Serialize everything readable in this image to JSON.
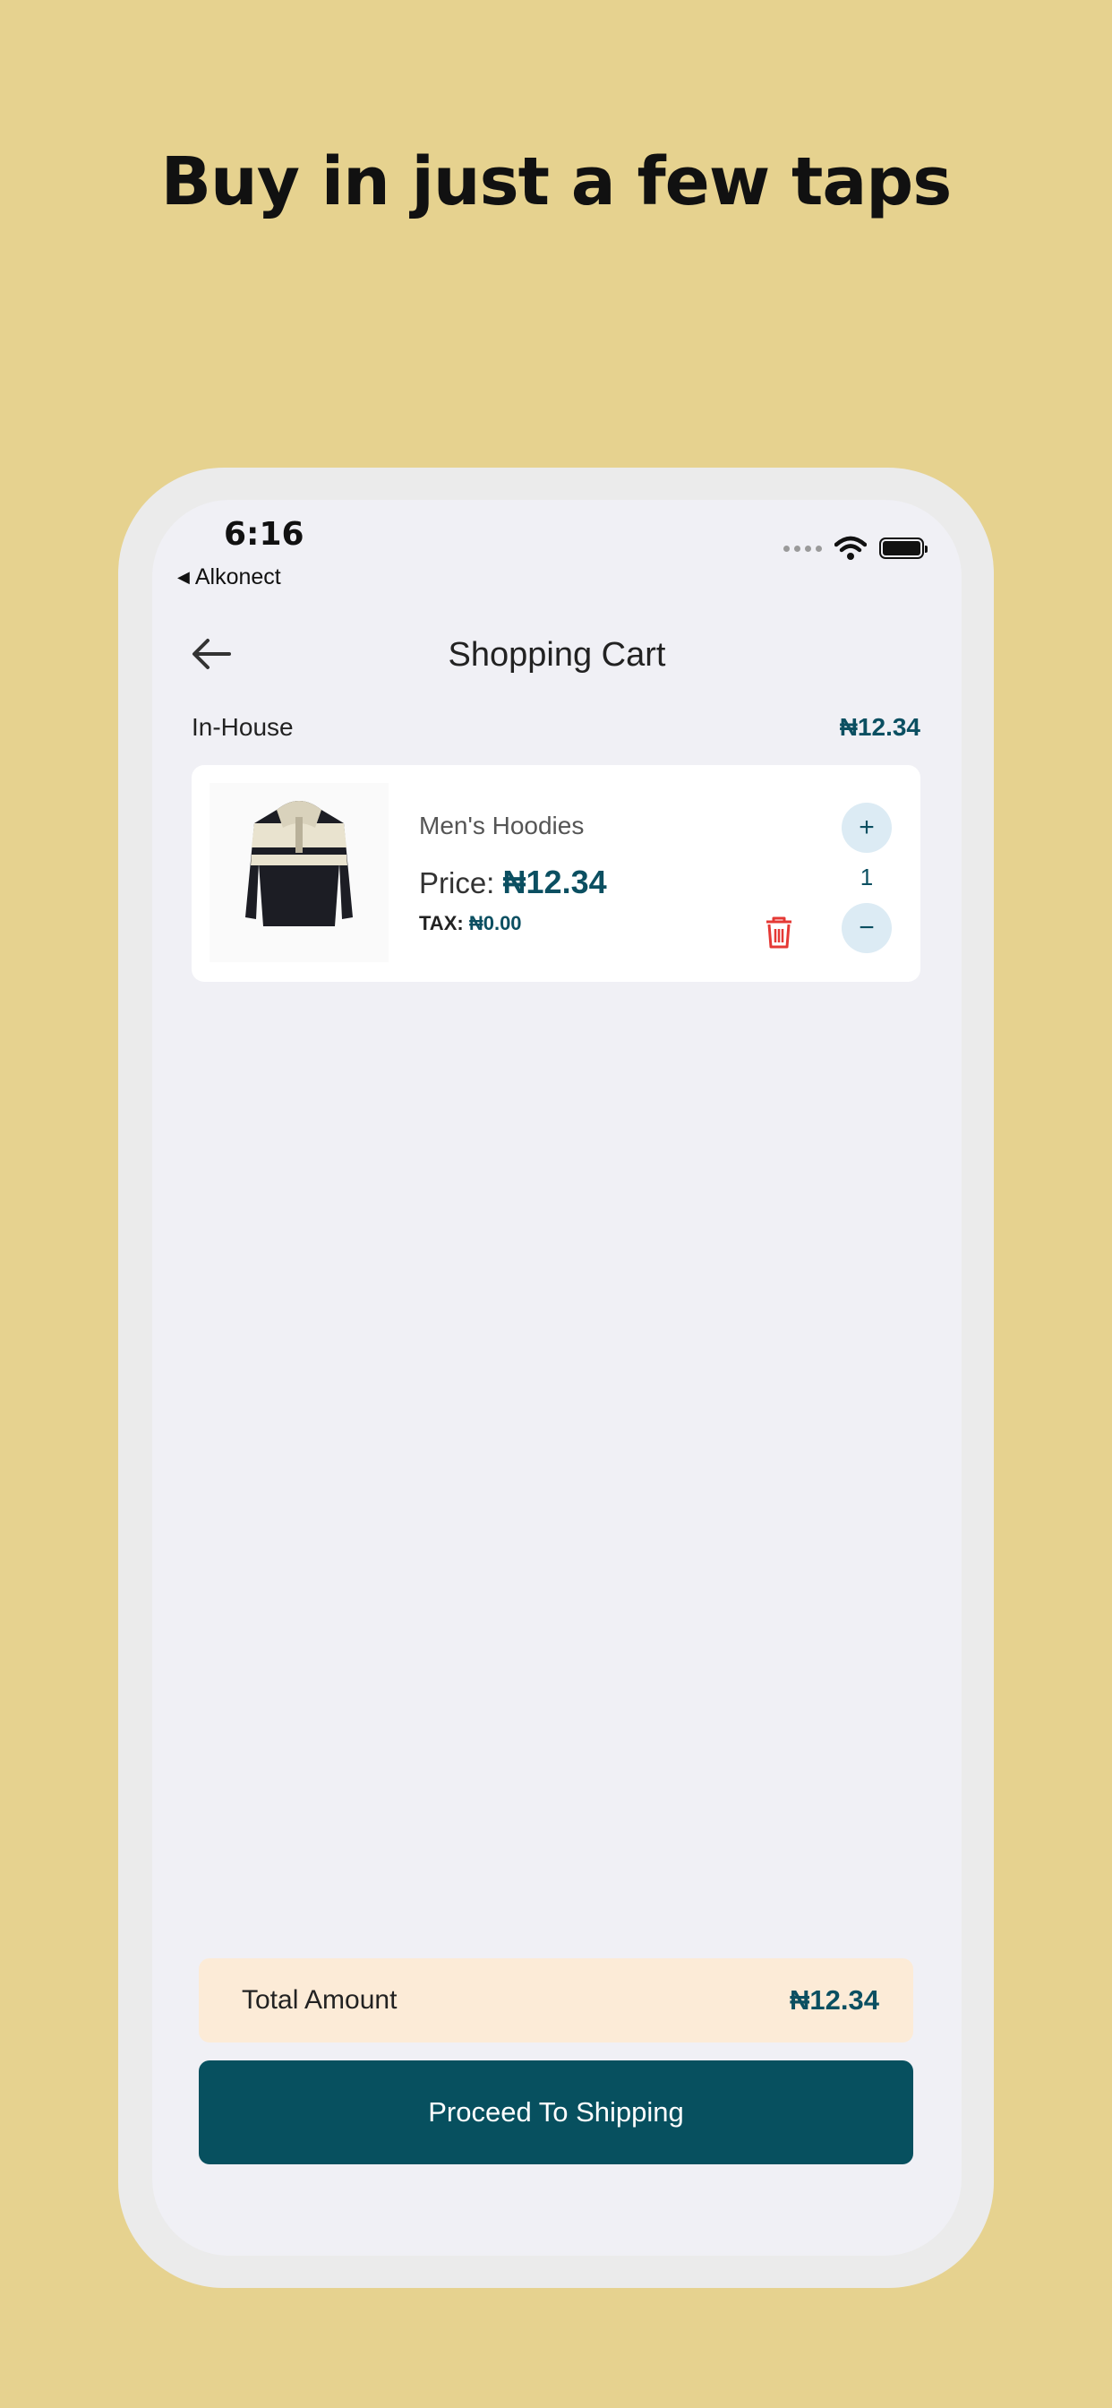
{
  "headline": "Buy in just a few taps",
  "status_bar": {
    "time": "6:16",
    "back_app": "Alkonect"
  },
  "header": {
    "title": "Shopping Cart"
  },
  "section": {
    "name": "In-House",
    "subtotal": "₦12.34"
  },
  "cart_items": [
    {
      "name": "Men's Hoodies",
      "price_label": "Price:",
      "price": "₦12.34",
      "tax_label": "TAX:",
      "tax": "₦0.00",
      "quantity": "1",
      "image": "hoodie-image"
    }
  ],
  "qty_controls": {
    "plus": "+",
    "minus": "−"
  },
  "footer": {
    "total_label": "Total Amount",
    "total_value": "₦12.34",
    "proceed_label": "Proceed To Shipping"
  },
  "colors": {
    "background": "#E6D28F",
    "accent": "#07505F",
    "total_bar": "#FCEBD7",
    "delete": "#E53935"
  }
}
